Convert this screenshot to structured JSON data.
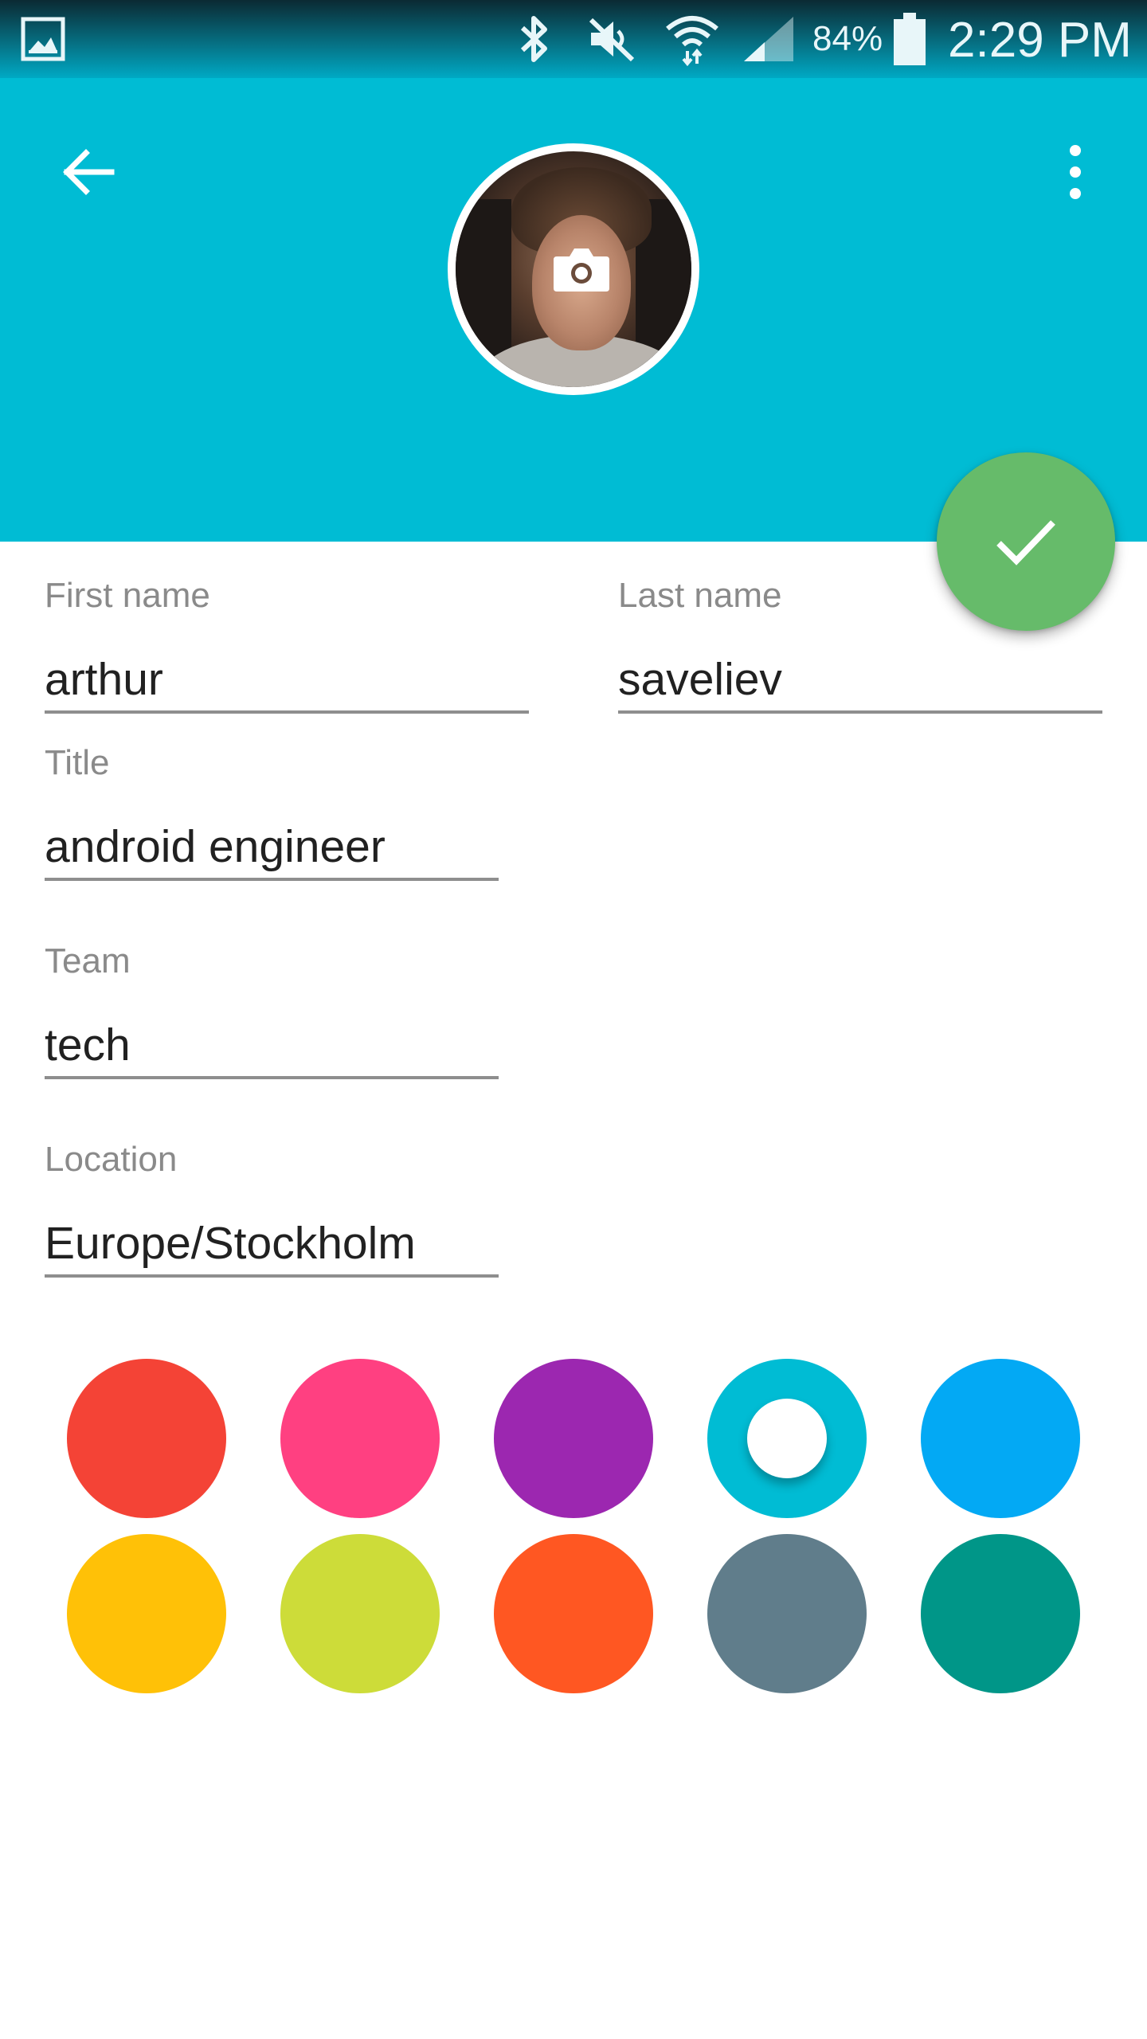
{
  "status_bar": {
    "battery_percent": "84%",
    "time": "2:29 PM",
    "icons": [
      "gallery-icon",
      "bluetooth-icon",
      "mute-icon",
      "wifi-icon",
      "signal-icon",
      "battery-icon"
    ]
  },
  "header": {
    "background_color": "#00bcd4",
    "back_icon": "arrow-back-icon",
    "menu_icon": "more-vert-icon",
    "avatar_overlay_icon": "camera-icon"
  },
  "fab": {
    "icon": "check-icon",
    "color": "#66bb6a"
  },
  "form": {
    "first_name": {
      "label": "First name",
      "value": "arthur"
    },
    "last_name": {
      "label": "Last name",
      "value": "saveliev"
    },
    "title": {
      "label": "Title",
      "value": "android engineer"
    },
    "team": {
      "label": "Team",
      "value": "tech"
    },
    "location": {
      "label": "Location",
      "value": "Europe/Stockholm"
    }
  },
  "palette": {
    "colors": [
      "#f44336",
      "#ff4081",
      "#9c27b0",
      "#00bcd4",
      "#03a9f4",
      "#ffc107",
      "#cddc39",
      "#ff5722",
      "#607d8b",
      "#009688"
    ],
    "selected_index": 3
  }
}
